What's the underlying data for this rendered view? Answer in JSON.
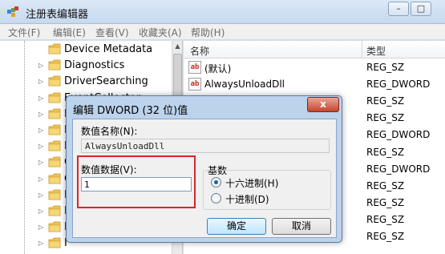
{
  "window": {
    "title": "注册表编辑器",
    "caption_buttons": [
      "–",
      "□"
    ]
  },
  "menu": [
    "文件(F)",
    "编辑(E)",
    "查看(V)",
    "收藏夹(A)",
    "帮助(H)"
  ],
  "tree": {
    "items": [
      {
        "label": "Device Metadata",
        "has_arrow": false
      },
      {
        "label": "Diagnostics",
        "has_arrow": true
      },
      {
        "label": "DriverSearching",
        "has_arrow": true
      },
      {
        "label": "EventCollector",
        "has_arrow": true
      },
      {
        "label": "E",
        "has_arrow": true
      },
      {
        "label": "E",
        "has_arrow": true
      },
      {
        "label": "E",
        "has_arrow": true
      },
      {
        "label": "G",
        "has_arrow": true
      },
      {
        "label": "G",
        "has_arrow": true
      },
      {
        "label": "H",
        "has_arrow": true
      },
      {
        "label": "H",
        "has_arrow": true
      },
      {
        "label": "H",
        "has_arrow": true
      },
      {
        "label": "I",
        "has_arrow": true
      }
    ]
  },
  "list": {
    "columns": [
      "名称",
      "类型"
    ],
    "rows": [
      {
        "name": "(默认)",
        "type": "REG_SZ",
        "icon": "ab"
      },
      {
        "name": "AlwaysUnloadDll",
        "type": "REG_DWORD",
        "icon": "ab"
      },
      {
        "name": "",
        "type": "REG_SZ",
        "icon": ""
      },
      {
        "name": "",
        "type": "REG_SZ",
        "icon": ""
      },
      {
        "name": "",
        "type": "REG_DWORD",
        "icon": ""
      },
      {
        "name": "",
        "type": "REG_SZ",
        "icon": ""
      },
      {
        "name": "",
        "type": "REG_DWORD",
        "icon": ""
      },
      {
        "name": "",
        "type": "REG_SZ",
        "icon": ""
      },
      {
        "name": "",
        "type": "REG_SZ",
        "icon": ""
      },
      {
        "name": "",
        "type": "REG_SZ",
        "icon": ""
      },
      {
        "name": "",
        "type": "REG_SZ",
        "icon": ""
      }
    ]
  },
  "dialog": {
    "title": "编辑 DWORD (32 位)值",
    "close_label": "x",
    "name_label": "数值名称(N):",
    "name_value": "AlwaysUnloadDll",
    "data_label": "数值数据(V):",
    "data_value": "1",
    "base_label": "基数",
    "radio_hex": "十六进制(H)",
    "radio_dec": "十进制(D)",
    "selected_base": "hex",
    "ok_label": "确定",
    "cancel_label": "取消"
  },
  "colors": {
    "highlight_box": "#d8262a",
    "default_button": "#3c7fb1"
  }
}
